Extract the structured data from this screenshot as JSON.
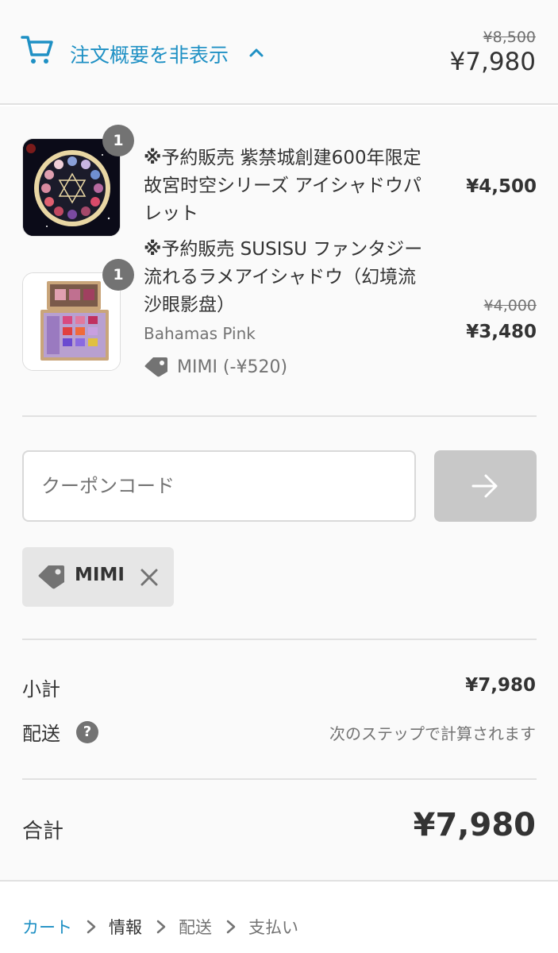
{
  "summary": {
    "toggle_label": "注文概要を非表示",
    "original_total": "¥8,500",
    "total": "¥7,980"
  },
  "items": [
    {
      "quantity": "1",
      "title_prefix": "※",
      "title": "予約販売 紫禁城創建600年限定 故宮时空シリーズ アイシャドウパレット",
      "price": "¥4,500"
    },
    {
      "quantity": "1",
      "title_prefix": "※",
      "title": "予約販売 SUSISU ファンタジー流れるラメアイシャドウ（幻境流沙眼影盘）",
      "variant": "Bahamas Pink",
      "discount_label": "MIMI (-¥520)",
      "original_price": "¥4,000",
      "price": "¥3,480"
    }
  ],
  "coupon": {
    "placeholder": "クーポンコード",
    "value": "",
    "applied_code": "MIMI"
  },
  "totals": {
    "subtotal_label": "小計",
    "subtotal_value": "¥7,980",
    "shipping_label": "配送",
    "shipping_value": "次のステップで計算されます",
    "total_label": "合計",
    "total_value": "¥7,980"
  },
  "help_icon_glyph": "?",
  "breadcrumb": [
    "カート",
    "情報",
    "配送",
    "支払い"
  ],
  "colors": {
    "accent": "#1e90c4",
    "text": "#333333",
    "muted": "#737373",
    "panel": "#fafafa",
    "button_disabled": "#c8c8c8"
  }
}
